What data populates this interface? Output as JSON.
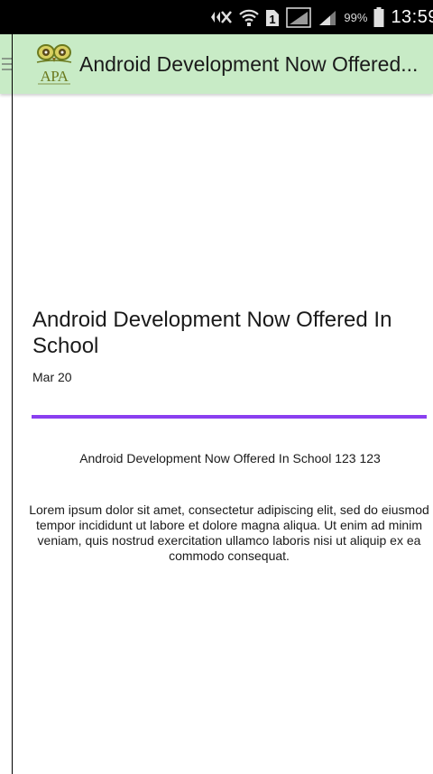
{
  "status_bar": {
    "battery_percent": "99%",
    "time": "13:59",
    "icons": [
      "signal-blocked-icon",
      "wifi-icon",
      "sim-1-icon",
      "signal-bars-icon",
      "signal-bars-icon",
      "battery-icon"
    ]
  },
  "app_bar": {
    "menu_icon": "hamburger-menu-icon",
    "logo_text": "APA",
    "title": "Android Development Now Offered..."
  },
  "article": {
    "title": "Android Development Now Offered In School",
    "date": "Mar 20",
    "subtitle": "Android Development Now Offered In School 123 123",
    "body": "Lorem ipsum dolor sit amet, consectetur adipiscing elit, sed do eiusmod tempor incididunt ut labore et dolore magna aliqua. Ut enim ad minim veniam, quis nostrud exercitation ullamco laboris nisi ut aliquip ex ea commodo consequat."
  },
  "colors": {
    "app_bar": "#c8ebc6",
    "divider": "#8a3ff0",
    "status_bar": "#000000"
  }
}
